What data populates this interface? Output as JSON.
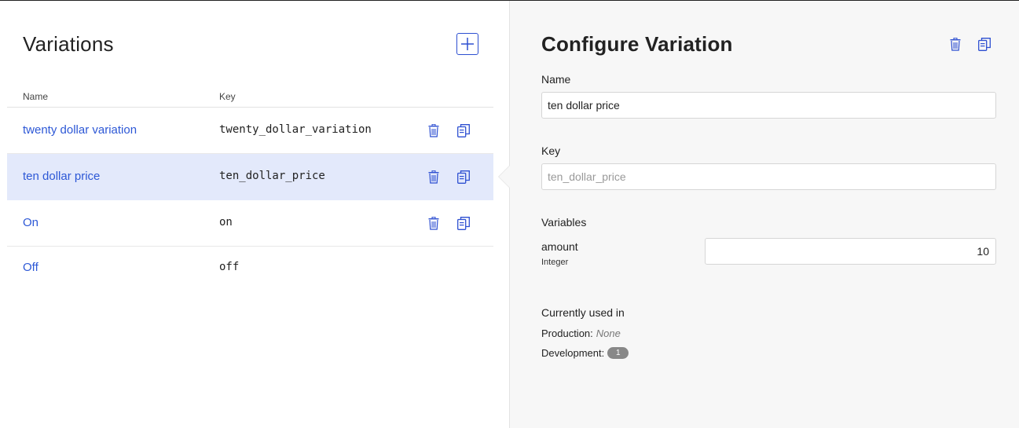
{
  "variations_panel": {
    "title": "Variations",
    "add_icon": "plus-icon",
    "columns": {
      "name": "Name",
      "key": "Key"
    },
    "rows": [
      {
        "name": "twenty dollar variation",
        "key": "twenty_dollar_variation",
        "has_actions": true,
        "selected": false
      },
      {
        "name": "ten dollar price",
        "key": "ten_dollar_price",
        "has_actions": true,
        "selected": true
      },
      {
        "name": "On",
        "key": "on",
        "has_actions": true,
        "selected": false
      },
      {
        "name": "Off",
        "key": "off",
        "has_actions": false,
        "selected": false
      }
    ],
    "row_icons": {
      "delete": "trash-icon",
      "duplicate": "copy-icon"
    }
  },
  "configure_panel": {
    "title": "Configure Variation",
    "name_label": "Name",
    "name_value": "ten dollar price",
    "key_label": "Key",
    "key_value": "ten_dollar_price",
    "variables_label": "Variables",
    "variable": {
      "name": "amount",
      "type": "Integer",
      "value": "10"
    },
    "used_in_label": "Currently used in",
    "production_label": "Production:",
    "production_value": "None",
    "development_label": "Development:",
    "development_count": "1"
  },
  "colors": {
    "link": "#2d58d6",
    "accent": "#2d4fd1",
    "selected_row": "#e3e9fb",
    "panel_bg": "#f7f7f7",
    "badge": "#888888"
  }
}
